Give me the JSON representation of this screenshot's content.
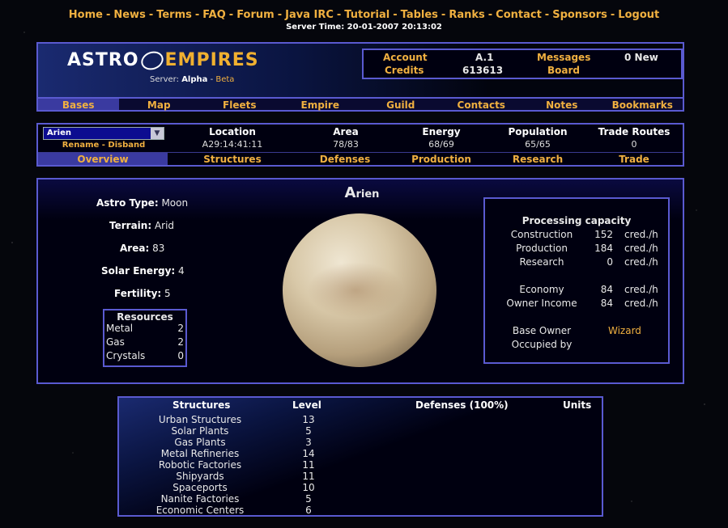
{
  "nav": [
    "Home",
    "News",
    "Terms",
    "FAQ",
    "Forum",
    "Java IRC",
    "Tutorial",
    "Tables",
    "Ranks",
    "Contact",
    "Sponsors",
    "Logout"
  ],
  "server_time": "Server Time: 20-01-2007 20:13:02",
  "logo": {
    "astro": "ASTRO",
    "empires": "EMPIRES"
  },
  "server": {
    "label": "Server:",
    "name": "Alpha",
    "sep": "-",
    "beta": "Beta"
  },
  "account": {
    "account_label": "Account",
    "account_value": "A.1",
    "messages_label": "Messages",
    "messages_value": "0 New",
    "credits_label": "Credits",
    "credits_value": "613613",
    "board_label": "Board"
  },
  "menu": [
    "Bases",
    "Map",
    "Fleets",
    "Empire",
    "Guild",
    "Contacts",
    "Notes",
    "Bookmarks"
  ],
  "base_select": "Arien",
  "rename_disband": "Rename - Disband",
  "base_stats": [
    {
      "label": "Location",
      "value": "A29:14:41:11"
    },
    {
      "label": "Area",
      "value": "78/83"
    },
    {
      "label": "Energy",
      "value": "68/69"
    },
    {
      "label": "Population",
      "value": "65/65"
    },
    {
      "label": "Trade Routes",
      "value": "0"
    }
  ],
  "subtabs": [
    "Overview",
    "Structures",
    "Defenses",
    "Production",
    "Research",
    "Trade"
  ],
  "base_name": {
    "first": "A",
    "rest": "rien"
  },
  "attributes": [
    {
      "label": "Astro Type:",
      "value": "Moon"
    },
    {
      "label": "Terrain:",
      "value": "Arid"
    },
    {
      "label": "Area:",
      "value": "83"
    },
    {
      "label": "Solar Energy:",
      "value": "4"
    },
    {
      "label": "Fertility:",
      "value": "5"
    }
  ],
  "resources": {
    "title": "Resources",
    "items": [
      {
        "name": "Metal",
        "value": "2"
      },
      {
        "name": "Gas",
        "value": "2"
      },
      {
        "name": "Crystals",
        "value": "0"
      }
    ]
  },
  "processing": {
    "title": "Processing capacity",
    "rows": [
      {
        "name": "Construction",
        "value": "152",
        "unit": "cred./h"
      },
      {
        "name": "Production",
        "value": "184",
        "unit": "cred./h"
      },
      {
        "name": "Research",
        "value": "0",
        "unit": "cred./h"
      },
      {
        "name": "Economy",
        "value": "84",
        "unit": "cred./h"
      },
      {
        "name": "Owner Income",
        "value": "84",
        "unit": "cred./h"
      }
    ],
    "owner_label": "Base Owner",
    "owner_value": "Wizard",
    "occupied_label": "Occupied by"
  },
  "structures_table": {
    "headers": {
      "structures": "Structures",
      "level": "Level",
      "defenses": "Defenses (100%)",
      "units": "Units"
    },
    "rows": [
      {
        "name": "Urban Structures",
        "level": "13"
      },
      {
        "name": "Solar Plants",
        "level": "5"
      },
      {
        "name": "Gas Plants",
        "level": "3"
      },
      {
        "name": "Metal Refineries",
        "level": "14"
      },
      {
        "name": "Robotic Factories",
        "level": "11"
      },
      {
        "name": "Shipyards",
        "level": "11"
      },
      {
        "name": "Spaceports",
        "level": "10"
      },
      {
        "name": "Nanite Factories",
        "level": "5"
      },
      {
        "name": "Economic Centers",
        "level": "6"
      }
    ]
  }
}
